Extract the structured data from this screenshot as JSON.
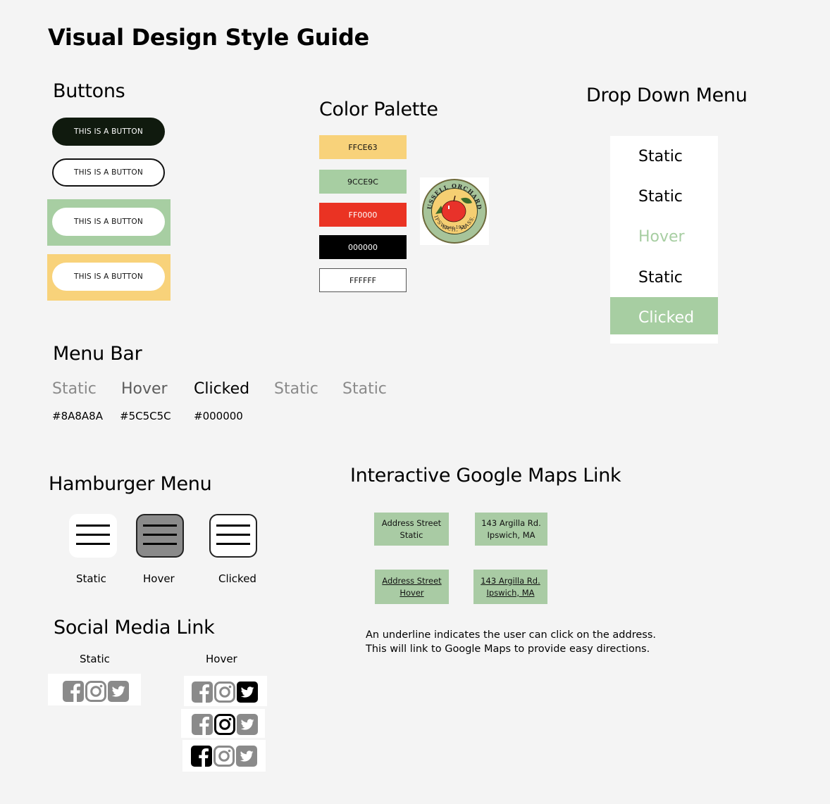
{
  "page_title": "Visual Design Style Guide",
  "buttons": {
    "heading": "Buttons",
    "items": [
      {
        "label": "THIS IS A BUTTON",
        "variant": "dark"
      },
      {
        "label": "THIS IS A BUTTON",
        "variant": "outline"
      },
      {
        "label": "THIS IS A BUTTON",
        "variant": "on-green"
      },
      {
        "label": "THIS IS A BUTTON",
        "variant": "on-yellow"
      }
    ]
  },
  "palette": {
    "heading": "Color Palette",
    "swatches": [
      {
        "hex": "FFCE63",
        "color": "#f8d27a",
        "text_color": "#111111"
      },
      {
        "hex": "9CCE9C",
        "color": "#a7cea2",
        "text_color": "#111111"
      },
      {
        "hex": "FF0000",
        "color": "#ea3323",
        "text_color": "#ffffff"
      },
      {
        "hex": "000000",
        "color": "#000000",
        "text_color": "#ffffff"
      },
      {
        "hex": "FFFFFF",
        "color": "#ffffff",
        "text_color": "#111111"
      }
    ],
    "logo": {
      "top_text": "RUSSELL ORCHARDS",
      "since": "Since 1920",
      "bottom_text": "IPSWICH, MASS."
    }
  },
  "dropdown": {
    "heading": "Drop Down Menu",
    "items": [
      "Static",
      "Static",
      "Hover",
      "Static",
      "Clicked"
    ],
    "hover_color": "#a7cea2",
    "clicked_bg": "#a7cea2"
  },
  "menu_bar": {
    "heading": "Menu Bar",
    "items": [
      "Static",
      "Hover",
      "Clicked",
      "Static",
      "Static"
    ],
    "hex_labels": [
      "#8A8A8A",
      "#5C5C5C",
      "#000000"
    ],
    "colors": {
      "static": "#8a8a8a",
      "hover": "#5c5c5c",
      "clicked": "#000000"
    }
  },
  "hamburger": {
    "heading": "Hamburger Menu",
    "states": [
      "Static",
      "Hover",
      "Clicked"
    ]
  },
  "maps": {
    "heading": "Interactive Google Maps Link",
    "static": {
      "label_line1": "Address Street",
      "label_line2": "Static",
      "addr_line1": "143 Argilla Rd.",
      "addr_line2": "Ipswich, MA"
    },
    "hover": {
      "label_line1": "Address Street",
      "label_line2": "Hover",
      "addr_line1": "143 Argilla Rd.",
      "addr_line2": "Ipswich, MA"
    },
    "note_line1": "An underline indicates the user can click on the address.",
    "note_line2": "This will link to Google Maps to provide easy directions."
  },
  "social": {
    "heading": "Social Media Link",
    "static_label": "Static",
    "hover_label": "Hover",
    "icons": [
      "facebook-icon",
      "instagram-icon",
      "twitter-icon"
    ],
    "static_color": "#8a8a8a",
    "hover_color": "#000000"
  }
}
